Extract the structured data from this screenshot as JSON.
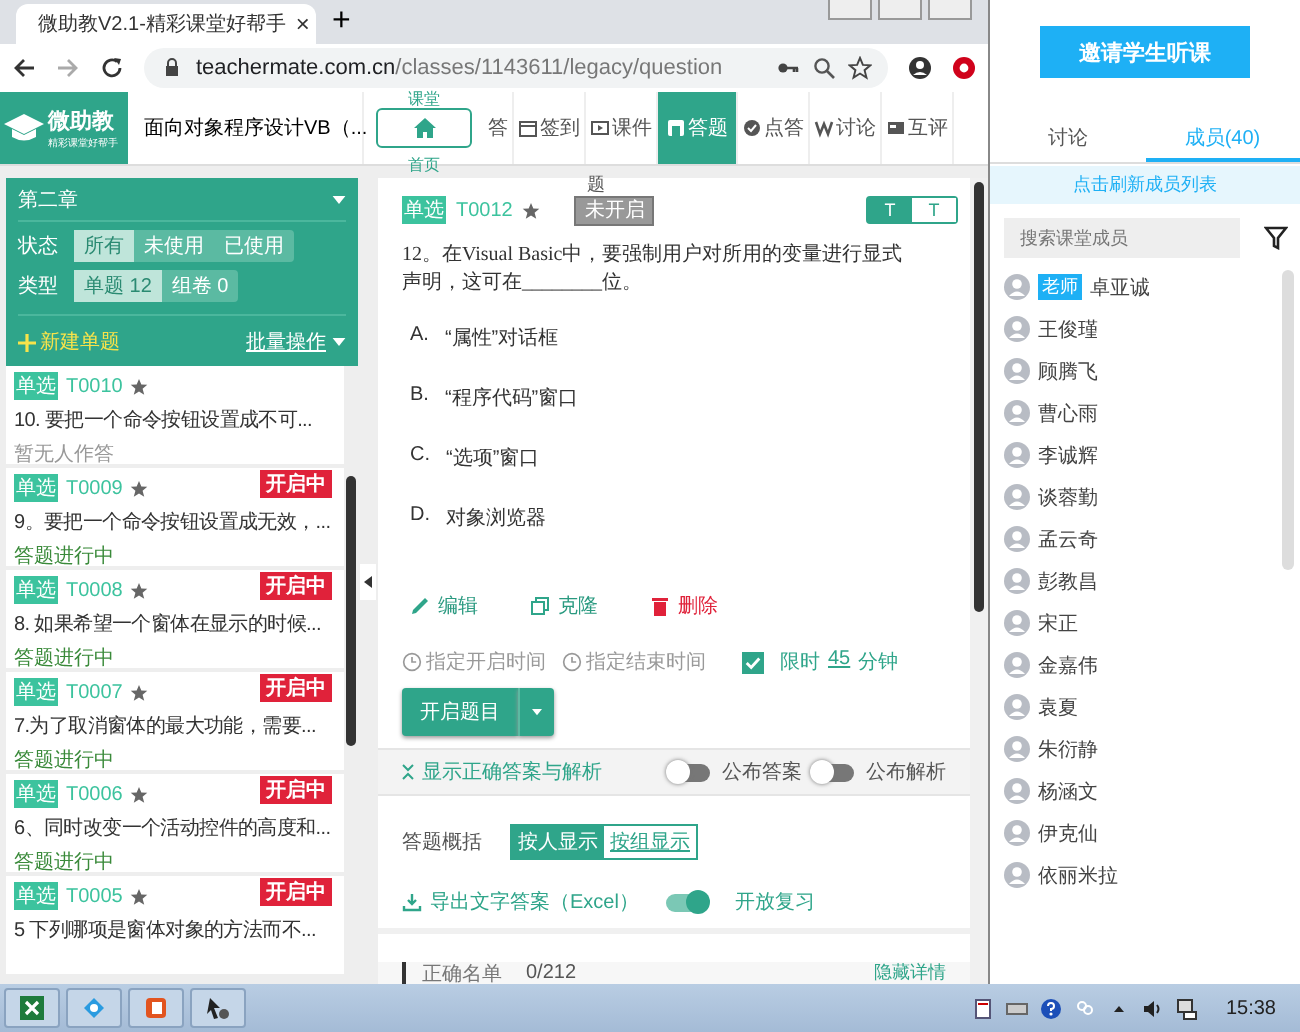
{
  "browser": {
    "tab_title": "微助教V2.1-精彩课堂好帮手",
    "tab_close": "×",
    "new_tab": "+",
    "url": {
      "host": "teachermate.com.cn",
      "path": "/classes/1143611/legacy/question"
    }
  },
  "app_nav": {
    "logo": "微助教",
    "logo_subtitle": "精彩课堂好帮手",
    "course": "面向对象程序设计VB（...",
    "home_above": "课堂",
    "home_below": "首页",
    "items": [
      {
        "label": "答",
        "selected": false
      },
      {
        "label": "签到",
        "selected": false
      },
      {
        "label": "课件",
        "selected": false
      },
      {
        "label": "答题",
        "selected": true
      },
      {
        "label": "点答",
        "selected": false
      },
      {
        "label": "讨论",
        "selected": false
      },
      {
        "label": "互评",
        "selected": false
      }
    ]
  },
  "sidebar": {
    "chapter": "第二章",
    "filters": [
      {
        "label": "状态",
        "options": [
          {
            "label": "所有",
            "selected": true
          },
          {
            "label": "未使用",
            "selected": false
          },
          {
            "label": "已使用",
            "selected": false
          }
        ]
      },
      {
        "label": "类型",
        "options": [
          {
            "label": "单题 12",
            "selected": true
          },
          {
            "label": "组卷 0",
            "selected": false
          }
        ]
      }
    ],
    "new_button": "新建单题",
    "batch": "批量操作",
    "items": [
      {
        "tag": "单选",
        "code": "T0010",
        "title": "10. 要把一个命令按钮设置成不可...",
        "status": "暂无人作答",
        "in_progress": false
      },
      {
        "tag": "单选",
        "code": "T0009",
        "badge": "开启中",
        "title": "9。要把一个命令按钮设置成无效，...",
        "status": "答题进行中",
        "in_progress": true
      },
      {
        "tag": "单选",
        "code": "T0008",
        "badge": "开启中",
        "title": "8. 如果希望一个窗体在显示的时候...",
        "status": "答题进行中",
        "in_progress": true
      },
      {
        "tag": "单选",
        "code": "T0007",
        "badge": "开启中",
        "title": "7.为了取消窗体的最大功能，需要...",
        "status": "答题进行中",
        "in_progress": true
      },
      {
        "tag": "单选",
        "code": "T0006",
        "badge": "开启中",
        "title": "6、同时改变一个活动控件的高度和...",
        "status": "答题进行中",
        "in_progress": true
      },
      {
        "tag": "单选",
        "code": "T0005",
        "badge": "开启中",
        "title": "5 下列哪项是窗体对象的方法而不..."
      }
    ]
  },
  "question": {
    "tag": "单选",
    "code": "T0012",
    "label_above": "题",
    "state": "未开启",
    "toggle": [
      {
        "label": "T",
        "selected": true
      },
      {
        "label": "T",
        "selected": false
      }
    ],
    "text": "12。在Visual Basic中，要强制用户对所用的变量进行显式声明，这可在________位。",
    "options": [
      {
        "letter": "A.",
        "text": "“属性”对话框"
      },
      {
        "letter": "B.",
        "text": "“程序代码”窗口"
      },
      {
        "letter": "C.",
        "text": "“选项”窗口"
      },
      {
        "letter": "D.",
        "text": "对象浏览器"
      }
    ],
    "actions": [
      {
        "kind": "edit",
        "label": "编辑"
      },
      {
        "kind": "clone",
        "label": "克隆"
      },
      {
        "kind": "delete",
        "label": "删除"
      }
    ],
    "start_time": "指定开启时间",
    "end_time": "指定结束时间",
    "time_limit": {
      "checked": true,
      "label": "限时",
      "minutes": "45",
      "unit": "分钟"
    },
    "open_button": "开启题目",
    "show_answer": "显示正确答案与解析",
    "publish": [
      {
        "label": "公布答案",
        "on": false
      },
      {
        "label": "公布解析",
        "on": false
      }
    ],
    "summary_label": "答题概括",
    "summary_modes": [
      {
        "label": "按人显示",
        "selected": true
      },
      {
        "label": "按组显示",
        "selected": false
      }
    ],
    "export": "导出文字答案（Excel）",
    "review": {
      "label": "开放复习",
      "on": true
    },
    "correct_list": "正确名单",
    "correct_count": "0/212",
    "hide_details": "隐藏详情"
  },
  "panel": {
    "invite_button": "邀请学生听课",
    "tabs": [
      {
        "label": "讨论",
        "selected": false
      },
      {
        "label": "成员(40)",
        "selected": true
      }
    ],
    "refresh": "点击刷新成员列表",
    "search": {
      "placeholder": "搜索课堂成员"
    },
    "members": [
      {
        "name": "卓亚诚",
        "badge": "老师"
      },
      {
        "name": "王俊瑾"
      },
      {
        "name": "顾腾飞"
      },
      {
        "name": "曹心雨"
      },
      {
        "name": "李诚辉"
      },
      {
        "name": "谈蓉勤"
      },
      {
        "name": "孟云奇"
      },
      {
        "name": "彭教昌"
      },
      {
        "name": "宋正"
      },
      {
        "name": "金嘉伟"
      },
      {
        "name": "袁夏"
      },
      {
        "name": "朱衍静"
      },
      {
        "name": "杨涵文"
      },
      {
        "name": "伊克仙"
      },
      {
        "name": "依丽米拉"
      }
    ]
  },
  "taskbar": {
    "time": "15:38"
  }
}
